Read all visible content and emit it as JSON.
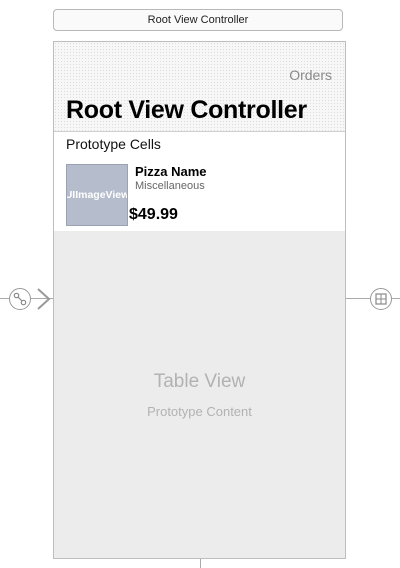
{
  "scene": {
    "title": "Root View Controller"
  },
  "navbar": {
    "right_item": "Orders",
    "large_title": "Root View Controller"
  },
  "table": {
    "section_header": "Prototype Cells",
    "cell": {
      "image_placeholder": "UIImageView",
      "title": "Pizza Name",
      "subtitle": "Miscellaneous",
      "price": "$49.99"
    },
    "placeholder_title": "Table View",
    "placeholder_subtitle": "Prototype Content"
  },
  "icons": {
    "left_connector": "segue-link-icon",
    "left_arrow": "segue-arrow-icon",
    "right_connector": "relationship-icon"
  }
}
